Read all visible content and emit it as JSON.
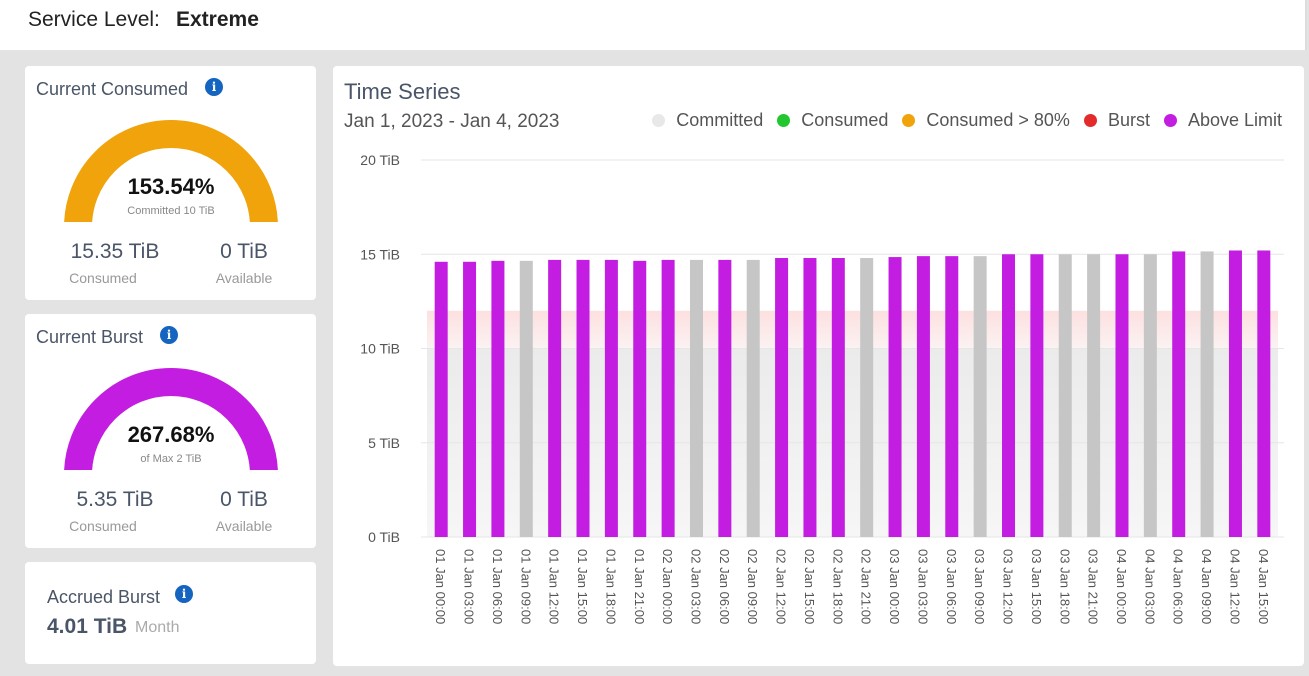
{
  "service_level": {
    "label": "Service Level:",
    "value": "Extreme"
  },
  "current_consumed": {
    "title": "Current Consumed",
    "percent_text": "153.54%",
    "percent_value": 153.54,
    "subtitle": "Committed 10 TiB",
    "consumed_value": "15.35 TiB",
    "consumed_label": "Consumed",
    "available_value": "0 TiB",
    "available_label": "Available",
    "color": "#f0a30a"
  },
  "current_burst": {
    "title": "Current Burst",
    "percent_text": "267.68%",
    "percent_value": 267.68,
    "subtitle": "of Max 2 TiB",
    "consumed_value": "5.35 TiB",
    "consumed_label": "Consumed",
    "available_value": "0 TiB",
    "available_label": "Available",
    "color": "#c21de0"
  },
  "accrued_burst": {
    "title": "Accrued Burst",
    "value": "4.01 TiB",
    "period": "Month"
  },
  "info_icon": "info-icon",
  "chart_data": {
    "type": "bar",
    "title": "Time Series",
    "subtitle": "Jan 1, 2023 - Jan 4, 2023",
    "legend": [
      {
        "name": "Committed",
        "color": "#e8e8e8"
      },
      {
        "name": "Consumed",
        "color": "#22c62e"
      },
      {
        "name": "Consumed > 80%",
        "color": "#f0a30a"
      },
      {
        "name": "Burst",
        "color": "#e42b2b"
      },
      {
        "name": "Above Limit",
        "color": "#c21de0"
      }
    ],
    "legend_position": "top-right",
    "y_ticks": [
      "0 TiB",
      "5 TiB",
      "10 TiB",
      "15 TiB",
      "20 TiB"
    ],
    "ylim": [
      0,
      20
    ],
    "committed": 10,
    "burst_limit": 12,
    "categories": [
      "01 Jan 00:00",
      "01 Jan 03:00",
      "01 Jan 06:00",
      "01 Jan 09:00",
      "01 Jan 12:00",
      "01 Jan 15:00",
      "01 Jan 18:00",
      "01 Jan 21:00",
      "02 Jan 00:00",
      "02 Jan 03:00",
      "02 Jan 06:00",
      "02 Jan 09:00",
      "02 Jan 12:00",
      "02 Jan 15:00",
      "02 Jan 18:00",
      "02 Jan 21:00",
      "03 Jan 00:00",
      "03 Jan 03:00",
      "03 Jan 06:00",
      "03 Jan 09:00",
      "03 Jan 12:00",
      "03 Jan 15:00",
      "03 Jan 18:00",
      "03 Jan 21:00",
      "04 Jan 00:00",
      "04 Jan 03:00",
      "04 Jan 06:00",
      "04 Jan 09:00",
      "04 Jan 12:00",
      "04 Jan 15:00"
    ],
    "values": [
      14.6,
      14.6,
      14.65,
      14.65,
      14.7,
      14.7,
      14.7,
      14.65,
      14.7,
      14.7,
      14.7,
      14.7,
      14.8,
      14.8,
      14.8,
      14.8,
      14.85,
      14.9,
      14.9,
      14.9,
      15.0,
      15.0,
      15.0,
      15.0,
      15.0,
      15.0,
      15.15,
      15.15,
      15.2,
      15.2
    ],
    "bar_color": "#c21de0",
    "gap_bar_color": "#c6c6c6"
  }
}
